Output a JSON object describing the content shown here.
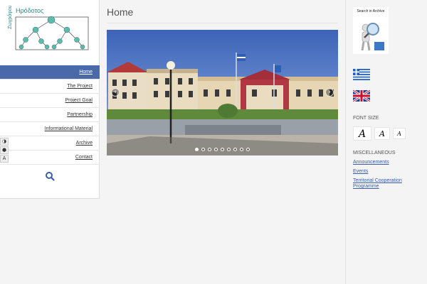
{
  "logo": {
    "text": "Ηρόδοτος",
    "side_text": "Ζωγράφου"
  },
  "nav": {
    "items": [
      {
        "label": "Home",
        "active": true
      },
      {
        "label": "The Project",
        "active": false
      },
      {
        "label": "Project Goal",
        "active": false
      },
      {
        "label": "Partnership",
        "active": false
      },
      {
        "label": "Informational Material",
        "active": false
      },
      {
        "label": "Archive",
        "active": false
      },
      {
        "label": "Contact",
        "active": false
      }
    ]
  },
  "accessibility": {
    "contrast_icon": "contrast-icon",
    "drop_icon": "drop-icon",
    "font_icon": "A"
  },
  "main": {
    "title": "Home",
    "slider": {
      "prev_glyph": "‹",
      "next_glyph": "›",
      "slide_count": 9,
      "active_slide": 0
    }
  },
  "right": {
    "archive_label": "Search in Archive",
    "font_size_label": "FONT SIZE",
    "font_size_buttons": [
      "A",
      "A",
      "A"
    ],
    "misc_label": "MISCELLANEOUS",
    "misc_links": [
      "Announcements",
      "Events",
      "Territorial Cooperation Programme"
    ]
  },
  "colors": {
    "accent": "#4a69a8",
    "link": "#3b5ca6"
  }
}
